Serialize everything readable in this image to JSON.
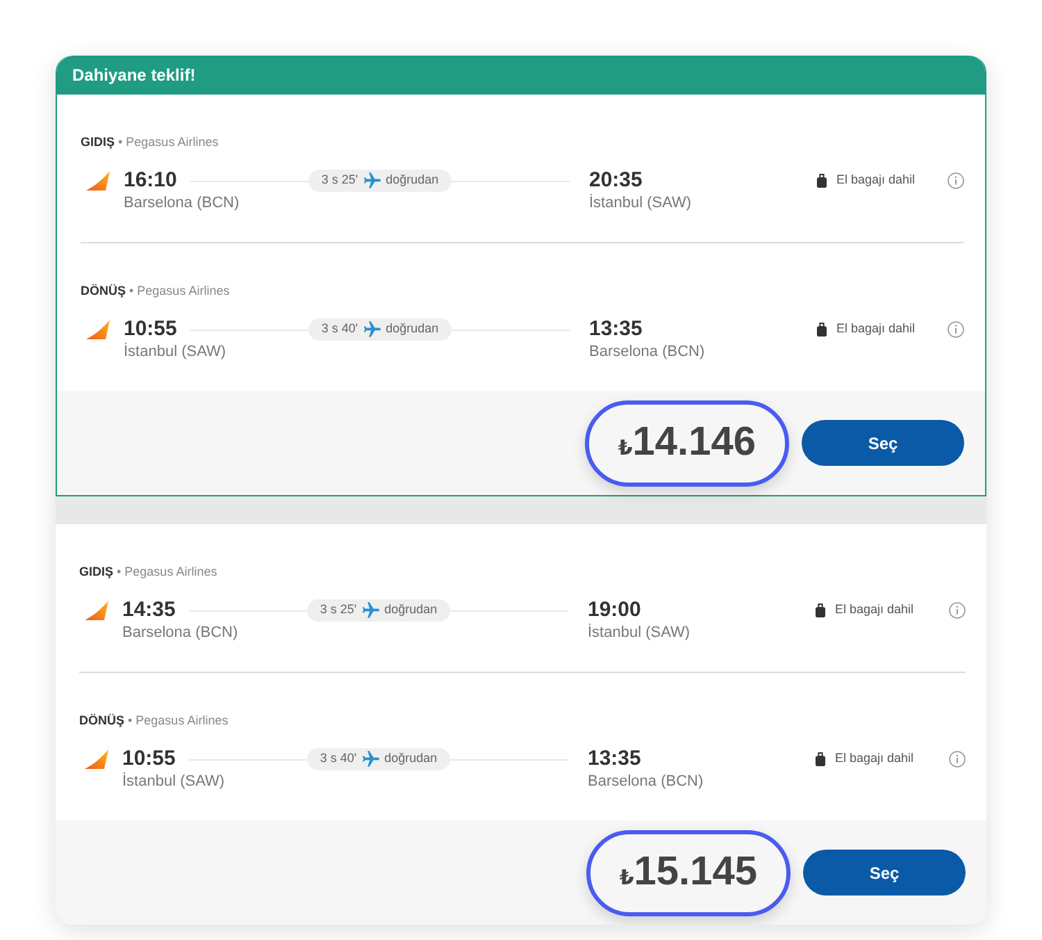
{
  "offers": [
    {
      "badge": "Dahiyane teklif!",
      "legs": [
        {
          "label": "**GIDIŞ** • Pegasus Airlines",
          "departure": {
            "time": "16:10",
            "city": "Barselona (BCN)"
          },
          "duration": "3 s 25'",
          "stops": "doğrudan",
          "arrival": {
            "time": "20:35",
            "city": "İstanbul (SAW)"
          },
          "baggage": "El bagajı dahil"
        },
        {
          "label": "**DÖNÜŞ** • Pegasus Airlines",
          "departure": {
            "time": "10:55",
            "city": "İstanbul (SAW)"
          },
          "duration": "3 s 40'",
          "stops": "doğrudan",
          "arrival": {
            "time": "13:35",
            "city": "Barselona (BCN)"
          },
          "baggage": "El bagajı dahil"
        }
      ],
      "price": {
        "currency": "₺",
        "amount": "14.146",
        "highlighted": true
      },
      "button": "Seç"
    },
    {
      "legs": [
        {
          "label": "**GIDIŞ** • Pegasus Airlines",
          "departure": {
            "time": "14:35",
            "city": "Barselona (BCN)"
          },
          "duration": "3 s 25'",
          "stops": "doğrudan",
          "arrival": {
            "time": "19:00",
            "city": "İstanbul (SAW)"
          },
          "baggage": "El bagajı dahil"
        },
        {
          "label": "**DÖNÜŞ** • Pegasus Airlines",
          "departure": {
            "time": "10:55",
            "city": "İstanbul (SAW)"
          },
          "duration": "3 s 40'",
          "stops": "doğrudan",
          "arrival": {
            "time": "13:35",
            "city": "Barselona (BCN)"
          },
          "baggage": "El bagajı dahil"
        }
      ],
      "price": {
        "currency": "₺",
        "amount": "15.145",
        "highlighted": true
      },
      "button": "Seç"
    }
  ]
}
